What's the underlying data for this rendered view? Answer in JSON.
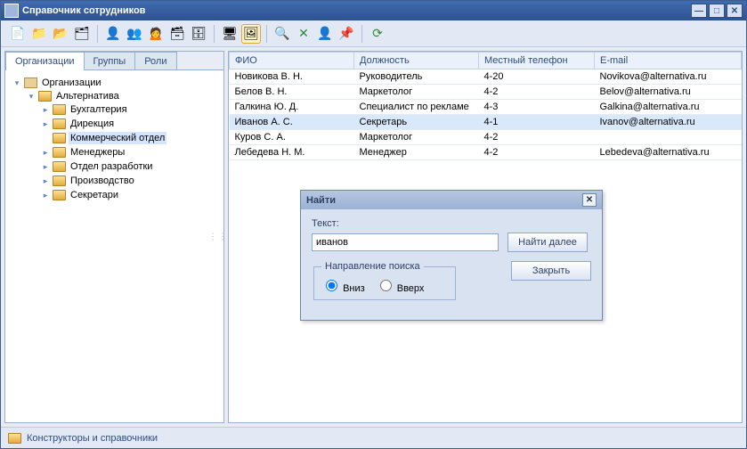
{
  "window": {
    "title": "Справочник сотрудников"
  },
  "tabs": {
    "t0": "Организации",
    "t1": "Группы",
    "t2": "Роли"
  },
  "tree": {
    "root": "Организации",
    "n1": "Альтернатива",
    "n1_1": "Бухгалтерия",
    "n1_2": "Дирекция",
    "n1_3": "Коммерческий отдел",
    "n1_4": "Менеджеры",
    "n1_5": "Отдел разработки",
    "n1_6": "Производство",
    "n1_7": "Секретари"
  },
  "table": {
    "headers": {
      "h0": "ФИО",
      "h1": "Должность",
      "h2": "Местный телефон",
      "h3": "E-mail"
    },
    "rows": [
      {
        "c0": "Новикова В. Н.",
        "c1": "Руководитель",
        "c2": "4-20",
        "c3": "Novikova@alternativa.ru"
      },
      {
        "c0": "Белов В. Н.",
        "c1": "Маркетолог",
        "c2": "4-2",
        "c3": "Belov@alternativa.ru"
      },
      {
        "c0": "Галкина Ю. Д.",
        "c1": "Специалист по рекламе",
        "c2": "4-3",
        "c3": "Galkina@alternativa.ru"
      },
      {
        "c0": "Иванов А. С.",
        "c1": "Секретарь",
        "c2": "4-1",
        "c3": "Ivanov@alternativa.ru"
      },
      {
        "c0": "Куров С. А.",
        "c1": "Маркетолог",
        "c2": "4-2",
        "c3": ""
      },
      {
        "c0": "Лебедева Н. М.",
        "c1": "Менеджер",
        "c2": "4-2",
        "c3": "Lebedeva@alternativa.ru"
      }
    ]
  },
  "find": {
    "title": "Найти",
    "text_label": "Текст:",
    "value": "иванов",
    "next_btn": "Найти далее",
    "close_btn": "Закрыть",
    "direction_legend": "Направление поиска",
    "down": "Вниз",
    "up": "Вверх"
  },
  "status": {
    "text": "Конструкторы и справочники"
  }
}
